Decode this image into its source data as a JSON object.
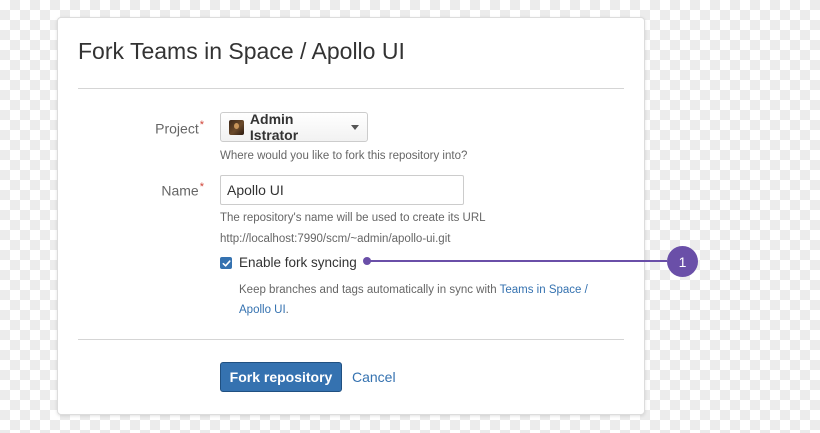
{
  "dialog": {
    "title": "Fork Teams in Space / Apollo UI"
  },
  "project": {
    "label": "Project",
    "required_mark": "*",
    "selected": "Admin Istrator",
    "help": "Where would you like to fork this repository into?"
  },
  "name": {
    "label": "Name",
    "required_mark": "*",
    "value": "Apollo UI",
    "help_line1": "The repository's name will be used to create its URL",
    "help_line2": "http://localhost:7990/scm/~admin/apollo-ui.git"
  },
  "sync": {
    "checked": true,
    "label": "Enable fork syncing",
    "help_prefix": "Keep branches and tags automatically in sync with ",
    "help_link": "Teams in Space / Apollo UI",
    "help_suffix": "."
  },
  "actions": {
    "submit": "Fork repository",
    "cancel": "Cancel"
  },
  "callout": {
    "number": "1",
    "color": "#6a4fa8"
  },
  "colors": {
    "primary": "#3572b0",
    "required": "#d04437"
  }
}
